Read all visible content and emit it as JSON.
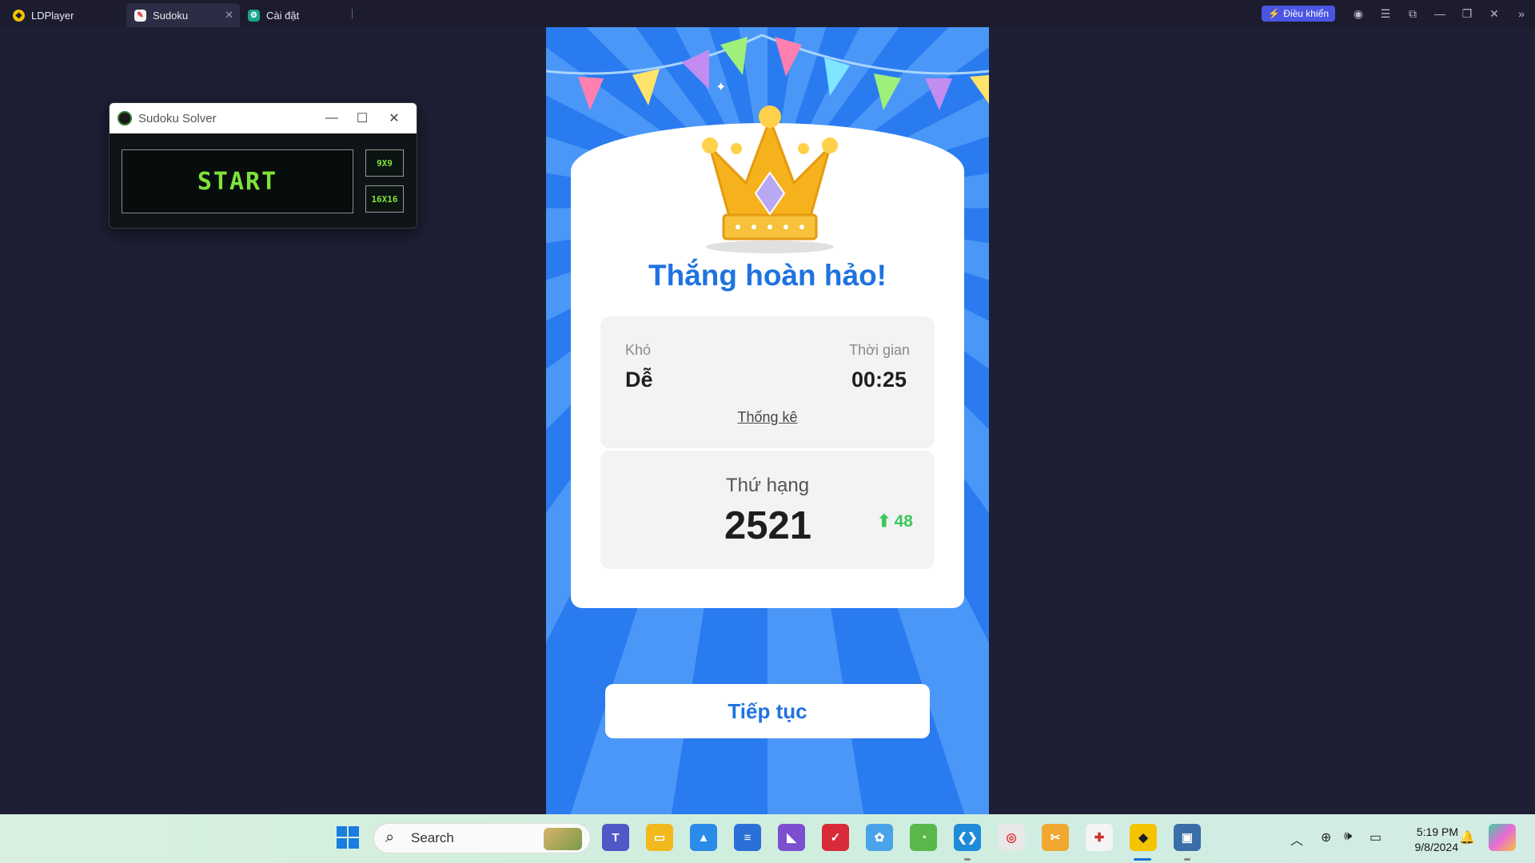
{
  "topbar": {
    "app_name": "LDPlayer",
    "tabs": [
      {
        "label": "Sudoku"
      },
      {
        "label": "Cài đặt"
      }
    ],
    "control_button": "Điều khiển"
  },
  "solver": {
    "title": "Sudoku Solver",
    "start_label": "START",
    "size_9": "9X9",
    "size_16": "16X16"
  },
  "game": {
    "title": "Thắng hoàn hảo!",
    "difficulty_label": "Khó",
    "difficulty_value": "Dễ",
    "time_label": "Thời gian",
    "time_value": "00:25",
    "stats_link": "Thống kê",
    "rank_label": "Thứ hạng",
    "rank_value": "2521",
    "rank_change": "48",
    "continue_label": "Tiếp tục"
  },
  "taskbar": {
    "search_placeholder": "Search",
    "time": "5:19 PM",
    "date": "9/8/2024"
  },
  "colors": {
    "accent_blue": "#1f73e0",
    "green_text": "#7ee33a",
    "rank_up": "#38c95a",
    "control_button_bg": "#4a56e2"
  }
}
